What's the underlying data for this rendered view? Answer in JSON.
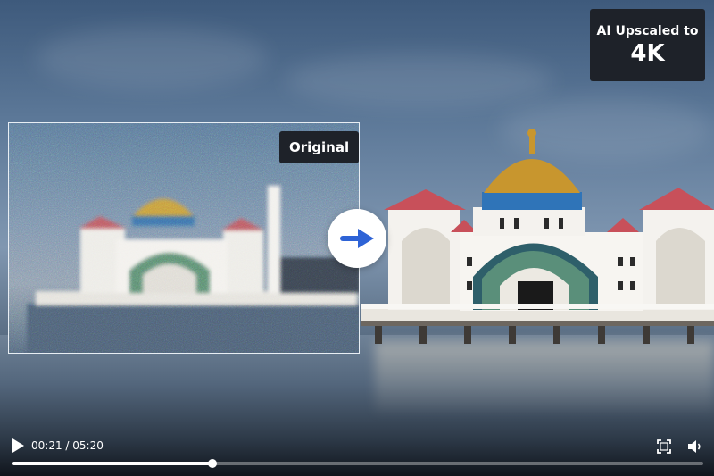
{
  "badges": {
    "original_label": "Original",
    "ai_line1": "AI Upscaled to",
    "ai_line2": "4K"
  },
  "player": {
    "current_time": "00:21",
    "duration": "05:20",
    "time_display": "00:21 / 05:20",
    "progress_fraction": 0.29,
    "icons": {
      "play": "play-icon",
      "fullscreen": "fullscreen-icon",
      "volume": "volume-icon",
      "compare": "arrow-right-icon"
    }
  },
  "colors": {
    "arrow": "#2e63d6",
    "badge_bg": "#1e2229",
    "dome": "#c8962e",
    "dome_band": "#2f74b8",
    "roof": "#c8505a"
  }
}
